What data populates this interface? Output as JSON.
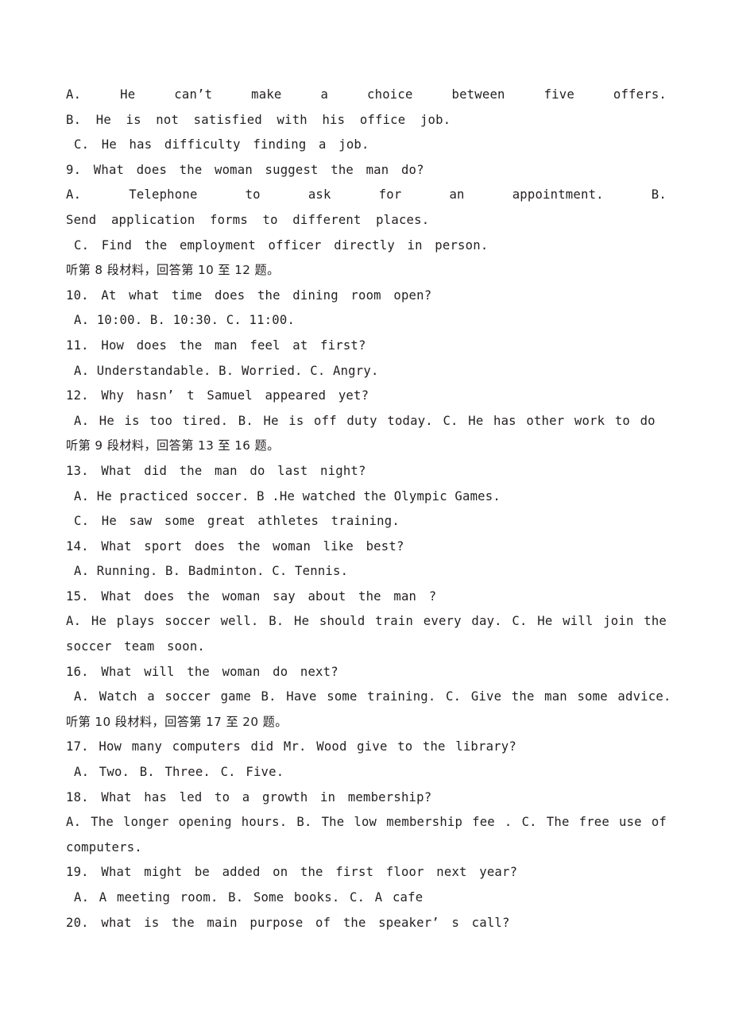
{
  "document": {
    "type": "exam-paper",
    "language": "zh-CN + en",
    "page_background": "#ffffff",
    "text_color": "#231f20"
  },
  "lines": [
    {
      "id": "l01",
      "kind": "options-justified",
      "text": "A.                                          He can’t make a choice between five offers."
    },
    {
      "id": "l02",
      "kind": "option",
      "text": "B.  He  is  not  satisfied  with  his  office  job."
    },
    {
      "id": "l03",
      "kind": "option",
      "text": "C. He  has  difficulty  finding  a  job."
    },
    {
      "id": "l04",
      "kind": "question",
      "text": "9. What  does  the  woman  suggest the man do?"
    },
    {
      "id": "l05",
      "kind": "options-justified",
      "text": "A.              Telephone  to  ask  for  an  appointment.                    B."
    },
    {
      "id": "l06",
      "kind": "option-cont",
      "text": "Send  application  forms  to  different  places."
    },
    {
      "id": "l07",
      "kind": "option",
      "text": "C. Find  the  employment  officer  directly  in  person."
    },
    {
      "id": "l08",
      "kind": "section-cn",
      "text": "听第 8 段材料，回答第 10 至 12 题。"
    },
    {
      "id": "l09",
      "kind": "question",
      "text": "10.  At  what  time  does  the  dining  room  open?"
    },
    {
      "id": "l10",
      "kind": "option",
      "text": "A. 10:00.         B. 10:30.        C. 11:00."
    },
    {
      "id": "l11",
      "kind": "question",
      "text": "11. How  does  the  man  feel  at  first?"
    },
    {
      "id": "l12",
      "kind": "option",
      "text": "A. Understandable.       B. Worried.    C. Angry."
    },
    {
      "id": "l13",
      "kind": "question",
      "text": "12.  Why hasn’ t  Samuel  appeared  yet?"
    },
    {
      "id": "l14",
      "kind": "option",
      "text": "A. He is too tired.    B. He  is  off  duty  today.     C. He  has  other  work  to  do"
    },
    {
      "id": "l15",
      "kind": "section-cn",
      "text": "听第 9 段材料，回答第 13 至 16 题。"
    },
    {
      "id": "l16",
      "kind": "question",
      "text": "13. What  did  the  man  do  last  night?"
    },
    {
      "id": "l17",
      "kind": "option",
      "text": "A. He practiced soccer.  B .He watched the Olympic  Games."
    },
    {
      "id": "l18",
      "kind": "option",
      "text": "C. He  saw  some  great  athletes  training."
    },
    {
      "id": "l19",
      "kind": "question",
      "text": "14.  What  sport  does  the  woman  like  best?"
    },
    {
      "id": "l20",
      "kind": "option",
      "text": "A. Running.        B. Badminton.        C. Tennis."
    },
    {
      "id": "l21",
      "kind": "question",
      "text": "15. What  does  the  woman  say  about  the man ?"
    },
    {
      "id": "l22",
      "kind": "options-justified",
      "text": "A.  He  plays  soccer  well.   B.  He  should  train  every  day.   C.  He  will  join  the"
    },
    {
      "id": "l23",
      "kind": "option-cont",
      "text": "soccer  team  soon."
    },
    {
      "id": "l24",
      "kind": "question",
      "text": "16. What  will  the  woman  do  next?"
    },
    {
      "id": "l25",
      "kind": "option",
      "text": "A. Watch  a  soccer  game  B. Have some  training.   C. Give the  man  some  advice."
    },
    {
      "id": "l26",
      "kind": "section-cn",
      "text": "听第 10 段材料，回答第 17 至 20 题。"
    },
    {
      "id": "l27",
      "kind": "question",
      "text": "17. How  many  computers  did Mr. Wood  give  to  the  library?"
    },
    {
      "id": "l28",
      "kind": "option",
      "text": "A. Two.   B. Three.  C. Five."
    },
    {
      "id": "l29",
      "kind": "question",
      "text": "18.   What  has  led  to  a  growth  in  membership?"
    },
    {
      "id": "l30",
      "kind": "options-justified",
      "text": "A.  The  longer  opening  hours.   B.  The  low  membership  fee .   C.  The  free  use  of"
    },
    {
      "id": "l31",
      "kind": "option-cont",
      "text": "computers."
    },
    {
      "id": "l32",
      "kind": "question",
      "text": "19.   What  might  be  added  on  the  first  floor  next  year?"
    },
    {
      "id": "l33",
      "kind": "option",
      "text": "A. A meeting room.   B. Some  books.   C. A cafe"
    },
    {
      "id": "l34",
      "kind": "question",
      "text": "20.   what  is  the  main  purpose  of  the  speaker’ s  call?"
    }
  ],
  "sections": [
    {
      "id": "s8",
      "heading": "听第 8 段材料，回答第 10 至 12 题。",
      "questions": [
        "10",
        "11",
        "12"
      ]
    },
    {
      "id": "s9",
      "heading": "听第 9 段材料，回答第 13 至 16 题。",
      "questions": [
        "13",
        "14",
        "15",
        "16"
      ]
    },
    {
      "id": "s10",
      "heading": "听第 10 段材料，回答第 17 至 20 题。",
      "questions": [
        "17",
        "18",
        "19",
        "20"
      ]
    }
  ],
  "questions": [
    {
      "number": "9",
      "prompt": "What  does  the  woman  suggest the man do?",
      "options": [
        "A.              Telephone  to  ask  for  an  appointment.",
        "B. Send  application  forms  to  different  places.",
        "C. Find  the  employment  officer  directly  in  person."
      ]
    },
    {
      "number": "10",
      "prompt": "At  what  time  does  the  dining  room  open?",
      "options": [
        "A. 10:00.",
        "B. 10:30.",
        "C. 11:00."
      ]
    },
    {
      "number": "11",
      "prompt": "How  does  the  man  feel  at  first?",
      "options": [
        "A. Understandable.",
        "B. Worried.",
        "C. Angry."
      ]
    },
    {
      "number": "12",
      "prompt": "Why hasn’ t  Samuel  appeared  yet?",
      "options": [
        "A. He is too tired.",
        "B. He  is  off  duty  today.",
        "C. He  has  other  work  to  do"
      ]
    },
    {
      "number": "13",
      "prompt": "What  did  the  man  do  last  night?",
      "options": [
        "A. He practiced soccer.",
        "B .He watched the Olympic  Games.",
        "C. He  saw  some  great  athletes  training."
      ]
    },
    {
      "number": "14",
      "prompt": "What  sport  does  the  woman  like  best?",
      "options": [
        "A. Running.",
        "B. Badminton.",
        "C. Tennis."
      ]
    },
    {
      "number": "15",
      "prompt": "What  does  the  woman  say  about  the man ?",
      "options": [
        "A.  He  plays  soccer  well.",
        "B.  He  should  train  every  day.",
        "C.  He  will  join  the soccer  team  soon."
      ]
    },
    {
      "number": "16",
      "prompt": "What  will  the  woman  do  next?",
      "options": [
        "A. Watch  a  soccer  game",
        "B. Have some  training.",
        "C. Give the  man  some  advice."
      ]
    },
    {
      "number": "17",
      "prompt": "How  many  computers  did Mr. Wood  give  to  the  library?",
      "options": [
        "A. Two.",
        "B. Three.",
        "C. Five."
      ]
    },
    {
      "number": "18",
      "prompt": "What  has  led  to  a  growth  in  membership?",
      "options": [
        "A.  The  longer  opening  hours.",
        "B.  The  low  membership  fee .",
        "C.  The  free  use  of computers."
      ]
    },
    {
      "number": "19",
      "prompt": "What  might  be  added  on  the  first  floor  next  year?",
      "options": [
        "A. A meeting room.",
        "B. Some  books.",
        "C. A cafe"
      ]
    },
    {
      "number": "20",
      "prompt": "what  is  the  main  purpose  of  the  speaker’ s  call?",
      "options": []
    }
  ],
  "partial_question_8_options": {
    "option_a": "He can’t make a choice between five offers.",
    "option_b": "B.  He  is  not  satisfied  with  his  office  job.",
    "option_c": "C. He  has  difficulty  finding  a  job."
  }
}
